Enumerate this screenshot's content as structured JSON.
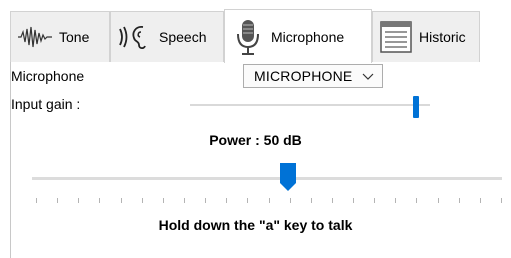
{
  "tabs": [
    {
      "label": "Tone",
      "icon": "waveform-icon"
    },
    {
      "label": "Speech",
      "icon": "ear-sound-icon"
    },
    {
      "label": "Microphone",
      "icon": "microphone-icon"
    },
    {
      "label": "Historic",
      "icon": "document-list-icon"
    }
  ],
  "active_tab": "Microphone",
  "microphone": {
    "label": "Microphone",
    "selected": "MICROPHONE"
  },
  "input_gain": {
    "label": "Input gain :",
    "level_fraction": 0.94
  },
  "power": {
    "text": "Power : 50 dB",
    "slider_fraction": 0.545,
    "tick_count": 23
  },
  "hint": "Hold down the \"a\" key to talk",
  "colors": {
    "accent": "#0072d6",
    "tab_bg": "#efefef",
    "track": "#dcdcdc"
  }
}
